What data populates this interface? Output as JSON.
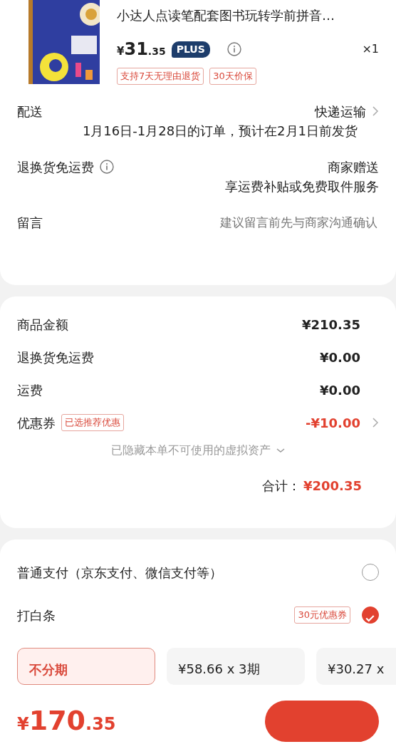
{
  "product": {
    "title": "小达人点读笔配套图书玩转学前拼音…",
    "price_symbol": "¥",
    "price_int": "31",
    "price_dec": ".35",
    "member_badge": "PLUS",
    "quantity": "×1",
    "tags": [
      "支持7天无理由退货",
      "30天价保"
    ]
  },
  "delivery": [
    {
      "label": "配送",
      "value": "快递运输",
      "note": "1月16日-1月28日的订单，预计在2月1日前发货",
      "info": false,
      "chevron": true
    },
    {
      "label": "退换货免运费",
      "value": "商家赠送",
      "note": "享运费补贴或免费取件服务",
      "info": true,
      "chevron": false
    }
  ],
  "message": {
    "label": "留言",
    "placeholder": "建议留言前先与商家沟通确认"
  },
  "summary": [
    {
      "label": "商品金额",
      "value": "¥210.35",
      "accent": false
    },
    {
      "label": "退换货免运费",
      "value": "¥0.00",
      "accent": false
    },
    {
      "label": "运费",
      "value": "¥0.00",
      "accent": false
    },
    {
      "label": "优惠券",
      "tag": "已选推荐优惠",
      "value": "-¥10.00",
      "accent": true
    }
  ],
  "hidden_assets": "已隐藏本单不可使用的虚拟资产",
  "total": {
    "label": "合计：",
    "value": "¥200.35"
  },
  "payment_methods": [
    {
      "label": "普通支付（京东支付、微信支付等）",
      "selected": false
    },
    {
      "label": "打白条",
      "tag": "30元优惠券",
      "selected": true
    }
  ],
  "installments": [
    {
      "label": "不分期",
      "selected": true
    },
    {
      "label": "¥58.66 x 3期",
      "selected": false
    },
    {
      "label": "¥30.27 x",
      "selected": false
    }
  ],
  "footer": {
    "symbol": "¥",
    "int": "170",
    "dec": ".35"
  }
}
